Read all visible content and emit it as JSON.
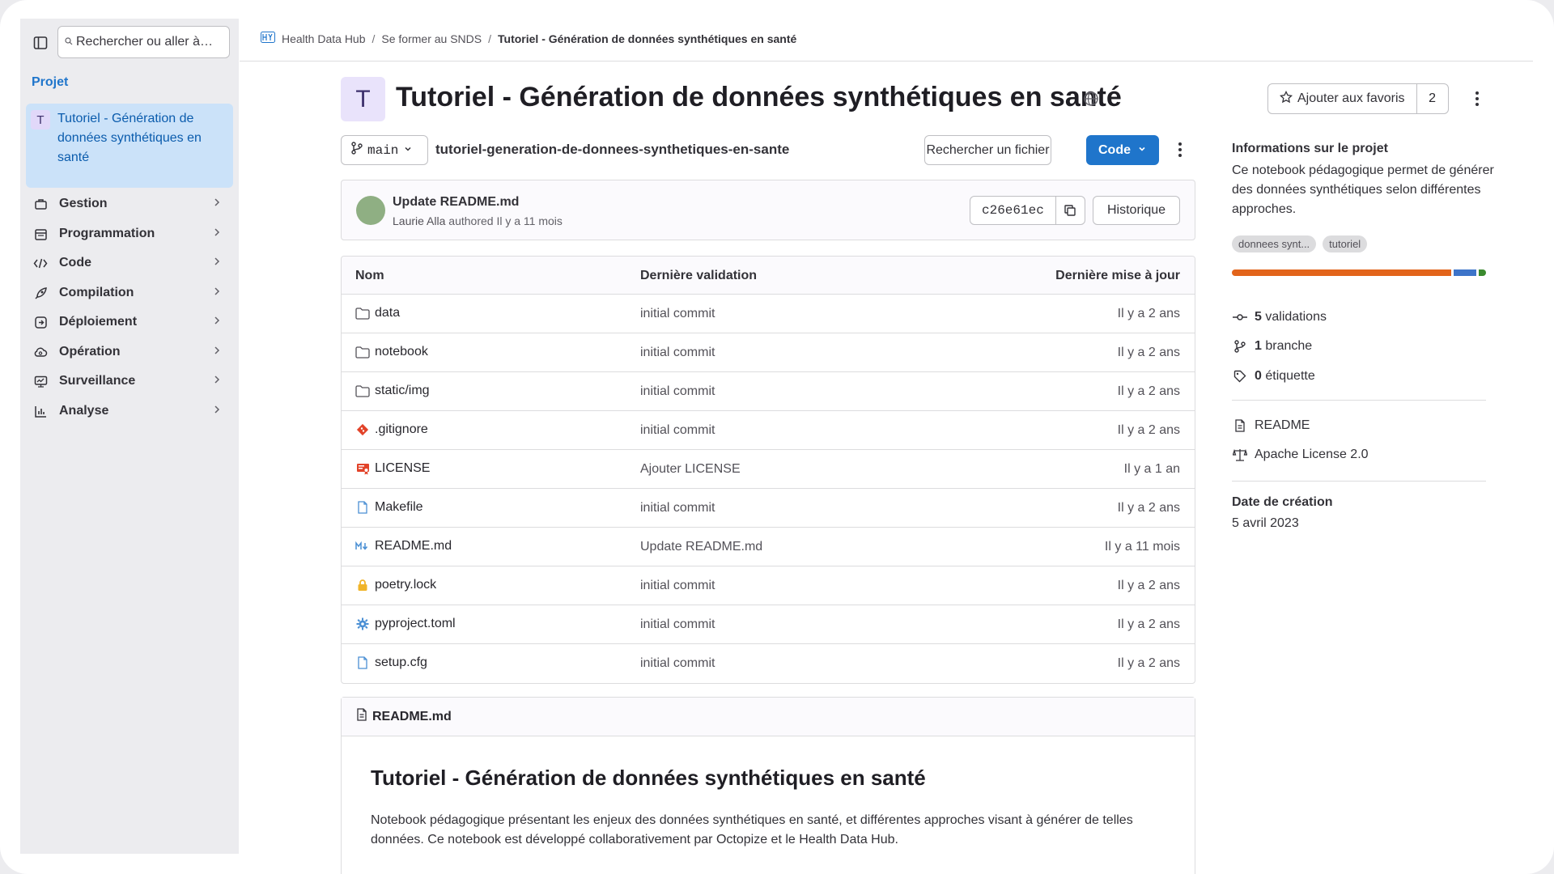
{
  "sidebar": {
    "search_placeholder": "Rechercher ou aller à…",
    "section": "Projet",
    "project": {
      "initial": "T",
      "label": "Tutoriel - Génération de données synthétiques en santé"
    },
    "items": [
      {
        "label": "Gestion",
        "icon": "briefcase-icon"
      },
      {
        "label": "Programmation",
        "icon": "calendar-icon"
      },
      {
        "label": "Code",
        "icon": "code-icon"
      },
      {
        "label": "Compilation",
        "icon": "rocket-icon"
      },
      {
        "label": "Déploiement",
        "icon": "deploy-icon"
      },
      {
        "label": "Opération",
        "icon": "cloud-gear-icon"
      },
      {
        "label": "Surveillance",
        "icon": "monitor-icon"
      },
      {
        "label": "Analyse",
        "icon": "chart-icon"
      }
    ]
  },
  "breadcrumb": {
    "group": "Health Data Hub",
    "subgroup": "Se former au SNDS",
    "current": "Tutoriel - Génération de données synthétiques en santé"
  },
  "header": {
    "initial": "T",
    "title": "Tutoriel - Génération de données synthétiques en santé",
    "star_label": "Ajouter aux favoris",
    "star_count": "2"
  },
  "repo": {
    "branch": "main",
    "path": "tutoriel-generation-de-donnees-synthetiques-en-sante",
    "find_file": "Rechercher un fichier",
    "code_button": "Code"
  },
  "last_commit": {
    "message": "Update README.md",
    "author": "Laurie Alla",
    "authored": "authored",
    "time": "Il y a 11 mois",
    "sha": "c26e61ec",
    "history": "Historique"
  },
  "files": {
    "columns": [
      "Nom",
      "Dernière validation",
      "Dernière mise à jour"
    ],
    "rows": [
      {
        "name": "data",
        "icon": "folder-icon",
        "commit": "initial commit",
        "date": "Il y a 2 ans"
      },
      {
        "name": "notebook",
        "icon": "folder-icon",
        "commit": "initial commit",
        "date": "Il y a 2 ans"
      },
      {
        "name": "static/img",
        "icon": "folder-icon",
        "commit": "initial commit",
        "date": "Il y a 2 ans"
      },
      {
        "name": ".gitignore",
        "icon": "git-icon",
        "commit": "initial commit",
        "date": "Il y a 2 ans"
      },
      {
        "name": "LICENSE",
        "icon": "license-icon",
        "commit": "Ajouter LICENSE",
        "date": "Il y a 1 an"
      },
      {
        "name": "Makefile",
        "icon": "file-icon",
        "commit": "initial commit",
        "date": "Il y a 2 ans"
      },
      {
        "name": "README.md",
        "icon": "markdown-icon",
        "commit": "Update README.md",
        "date": "Il y a 11 mois"
      },
      {
        "name": "poetry.lock",
        "icon": "lock-icon",
        "commit": "initial commit",
        "date": "Il y a 2 ans"
      },
      {
        "name": "pyproject.toml",
        "icon": "gear-icon",
        "commit": "initial commit",
        "date": "Il y a 2 ans"
      },
      {
        "name": "setup.cfg",
        "icon": "file-icon",
        "commit": "initial commit",
        "date": "Il y a 2 ans"
      }
    ]
  },
  "readme": {
    "filename": "README.md",
    "title": "Tutoriel - Génération de données synthétiques en santé",
    "text": "Notebook pédagogique présentant les enjeux des données synthétiques en santé, et différentes approches visant à générer de telles données. Ce notebook est développé collaborativement par Octopize et le Health Data Hub."
  },
  "project_info": {
    "title": "Informations sur le projet",
    "description": "Ce notebook pédagogique permet de générer des données synthétiques selon différentes approches.",
    "topics": [
      "donnees synt...",
      "tutoriel"
    ],
    "languages": [
      {
        "color": "#e2641b",
        "share": 0.88
      },
      {
        "color": "#3d74c9",
        "share": 0.09
      },
      {
        "color": "#3a8a2e",
        "share": 0.03
      }
    ],
    "commits_count": "5",
    "commits_label": "validations",
    "branches_count": "1",
    "branches_label": "branche",
    "tags_count": "0",
    "tags_label": "étiquette",
    "readme": "README",
    "license": "Apache License 2.0",
    "created_label": "Date de création",
    "created_value": "5 avril 2023"
  }
}
